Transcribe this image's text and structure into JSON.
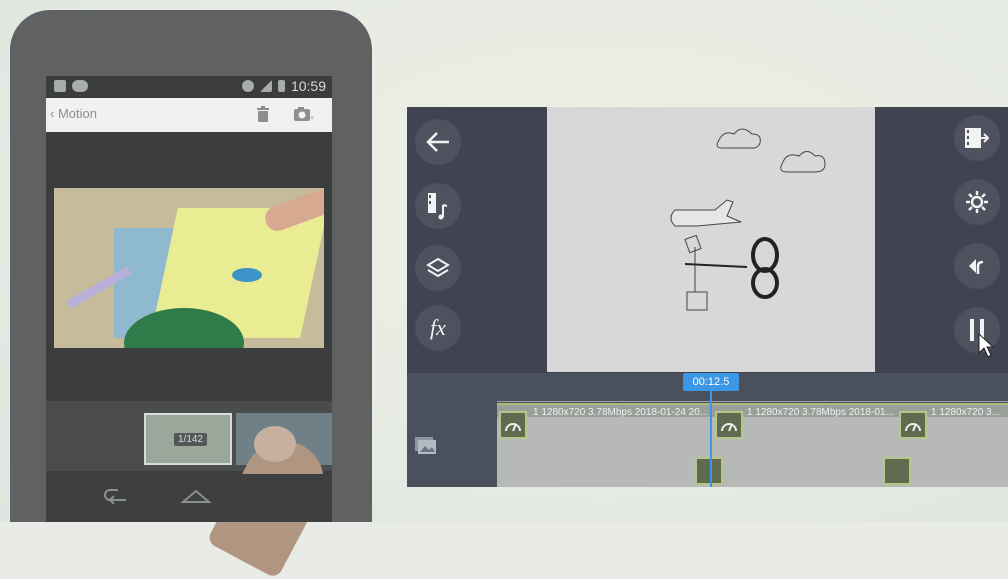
{
  "phone": {
    "status_time": "10:59",
    "title": "Motion",
    "back_glyph": "‹",
    "thumb_counter": "1/142",
    "icons": [
      "image-icon",
      "voicemail-icon",
      "alarm-icon",
      "signal-icon",
      "battery-icon",
      "trash-icon",
      "add-camera-icon",
      "back-nav-icon",
      "home-nav-icon"
    ]
  },
  "editor": {
    "playhead_time": "00:12.5",
    "clips": [
      {
        "label": "1280x720 3.78Mbps 2018-01-24 20..."
      },
      {
        "label": "1280x720 3.78Mbps 2018-01..."
      },
      {
        "label": "1280x720 3..."
      }
    ],
    "left_tools": [
      "back-arrow-icon",
      "media-music-icon",
      "layers-icon",
      "fx-icon"
    ],
    "right_tools": [
      "export-icon",
      "settings-icon",
      "undo-icon",
      "pause-icon"
    ],
    "fx_label": "fx",
    "clip_prefix": "1"
  },
  "colors": {
    "accent": "#3c97e6",
    "clip_border": "#b9c48a"
  }
}
